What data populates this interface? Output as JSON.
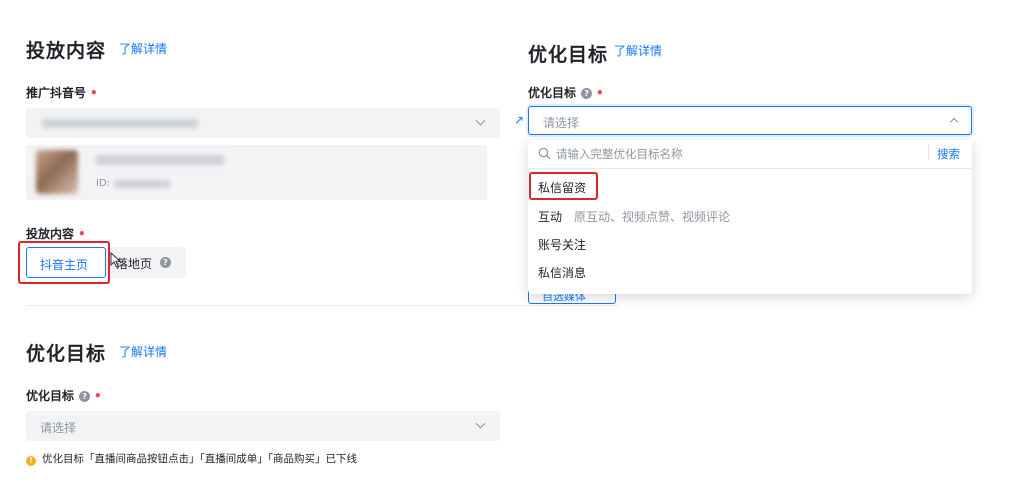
{
  "left": {
    "content_section": {
      "title": "投放内容",
      "learn_more": "了解详情",
      "account_label": "推广抖音号",
      "account_id_prefix": "ID:",
      "content_label": "投放内容",
      "content_options": [
        "抖音主页",
        "落地页"
      ],
      "selected_option": "抖音主页"
    },
    "goal_section": {
      "title": "优化目标",
      "learn_more": "了解详情",
      "goal_label": "优化目标",
      "placeholder": "请选择",
      "notice": "优化目标「直播间商品按钮点击」「直播间成单」「商品购买」已下线"
    }
  },
  "right": {
    "goal_section": {
      "title": "优化目标",
      "learn_more": "了解详情",
      "goal_label": "优化目标",
      "placeholder": "请选择",
      "search_placeholder": "请输入完整优化目标名称",
      "search_button": "搜索",
      "options": [
        {
          "label": "私信留资",
          "desc": ""
        },
        {
          "label": "互动",
          "desc": "原互动、视频点赞、视频评论"
        },
        {
          "label": "账号关注",
          "desc": ""
        },
        {
          "label": "私信消息",
          "desc": ""
        }
      ],
      "peek_button": "自选媒体"
    }
  },
  "colors": {
    "accent": "#1677ff",
    "required": "#f5454f",
    "highlight": "#e0242c",
    "warning": "#faad14"
  }
}
